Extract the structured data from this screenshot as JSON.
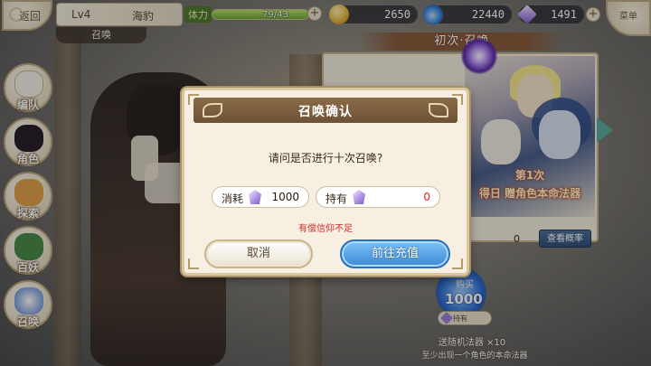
{
  "topbar": {
    "back_label": "返回",
    "level": "Lv4",
    "player_name": "海豹",
    "sub_title": "召唤",
    "stamina_label": "体力",
    "stamina_value": "79/43",
    "stamina_fill_fraction": 1.0,
    "gold": "2650",
    "flame": "22440",
    "crystal": "1491",
    "menu_label": "菜单"
  },
  "sidebar": {
    "items": [
      {
        "label": "编队",
        "icon": "formation-icon"
      },
      {
        "label": "角色",
        "icon": "character-icon"
      },
      {
        "label": "探索",
        "icon": "explore-icon"
      },
      {
        "label": "百妖",
        "icon": "bestiary-icon"
      },
      {
        "label": "召唤",
        "icon": "summon-icon"
      }
    ]
  },
  "banner": {
    "title": "初次·召唤",
    "text_line1": "第1次",
    "text_line2": "得日 赠角色本命法器",
    "count": "0",
    "rate_button": "查看概率",
    "buy_label": "购买",
    "buy_amount": "1000",
    "own_label": "持有",
    "gift_line": "送随机法器 ×10",
    "hint_line": "至少出现一个角色的本命法器"
  },
  "dialog": {
    "title": "召唤确认",
    "question": "请问是否进行十次召唤?",
    "cost_label": "消耗",
    "cost_value": "1000",
    "own_label": "持有",
    "own_value": "0",
    "warning": "有偿信仰不足",
    "cancel_label": "取消",
    "recharge_label": "前往充值"
  },
  "colors": {
    "warning_red": "#d02a2a",
    "recharge_blue": "#3b87d6",
    "header_brown": "#6d5236"
  }
}
